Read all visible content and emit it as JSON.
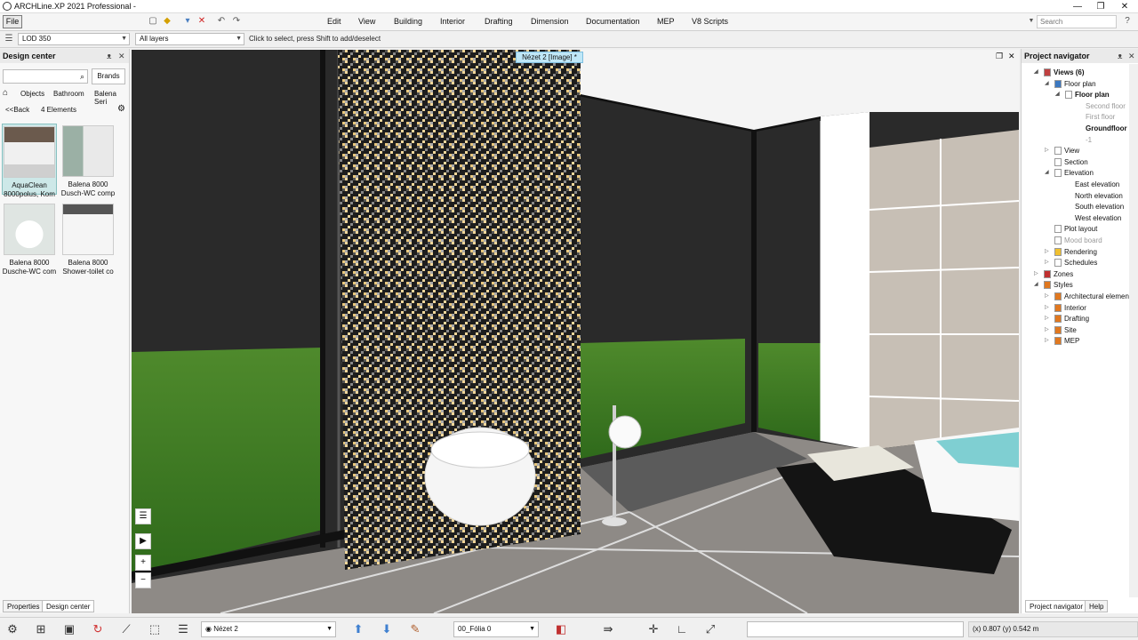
{
  "window": {
    "title": "ARCHLine.XP 2021  Professional -",
    "controls": [
      "—",
      "❐",
      "✕"
    ]
  },
  "menubar": {
    "file_label": "File",
    "items": [
      "Edit",
      "View",
      "Building",
      "Interior",
      "Drafting",
      "Dimension",
      "Documentation",
      "MEP",
      "V8 Scripts"
    ],
    "search_placeholder": "Search"
  },
  "toolbar2": {
    "lod_value": "LOD 350",
    "layers_value": "All layers",
    "hint": "Click to select, press Shift to add/deselect"
  },
  "design_center": {
    "title": "Design center",
    "brands_label": "Brands",
    "breadcrumbs": [
      "Objects",
      "Bathroom",
      "Balena Seri"
    ],
    "back_label": "<<Back",
    "count_label": "4 Elements",
    "items": [
      {
        "line1": "AquaClean",
        "line2": "8000polus, Kom",
        "selected": true
      },
      {
        "line1": "Balena 8000",
        "line2": "Dusch-WC comp",
        "selected": false
      },
      {
        "line1": "Balena 8000",
        "line2": "Dusche-WC com",
        "selected": false
      },
      {
        "line1": "Balena 8000",
        "line2": "Shower-toilet co",
        "selected": false
      }
    ],
    "tabs": [
      "Properties",
      "Design center"
    ]
  },
  "viewport": {
    "tab_label": "Nézet 2 [Image] *"
  },
  "project_navigator": {
    "title": "Project navigator",
    "tree": [
      {
        "label": "Views (6)",
        "level": 0,
        "bold": true,
        "expand": "◢",
        "icon": "views-icon"
      },
      {
        "label": "Floor plan",
        "level": 1,
        "expand": "◢",
        "icon": "floorplan-icon"
      },
      {
        "label": "Floor plan",
        "level": 2,
        "bold": true,
        "expand": "◢",
        "icon": "page-icon"
      },
      {
        "label": "Second floor",
        "level": 3,
        "greyed": true
      },
      {
        "label": "First floor",
        "level": 3,
        "greyed": true
      },
      {
        "label": "Groundfloor",
        "level": 3,
        "bold": true
      },
      {
        "label": "-1",
        "level": 3,
        "greyed": true
      },
      {
        "label": "View",
        "level": 1,
        "expand": "▷",
        "icon": "page-icon"
      },
      {
        "label": "Section",
        "level": 1,
        "icon": "page-icon"
      },
      {
        "label": "Elevation",
        "level": 1,
        "expand": "◢",
        "icon": "page-icon"
      },
      {
        "label": "East elevation",
        "level": 2
      },
      {
        "label": "North elevation",
        "level": 2
      },
      {
        "label": "South elevation",
        "level": 2
      },
      {
        "label": "West elevation",
        "level": 2
      },
      {
        "label": "Plot layout",
        "level": 1,
        "icon": "page-icon"
      },
      {
        "label": "Mood board",
        "level": 1,
        "greyed": true,
        "icon": "page-icon"
      },
      {
        "label": "Rendering",
        "level": 1,
        "expand": "▷",
        "icon": "folder-icon"
      },
      {
        "label": "Schedules",
        "level": 1,
        "expand": "▷",
        "icon": "page-icon"
      },
      {
        "label": "Zones",
        "level": 0,
        "expand": "▷",
        "icon": "zones-icon"
      },
      {
        "label": "Styles",
        "level": 0,
        "expand": "◢",
        "icon": "styles-icon"
      },
      {
        "label": "Architectural elements",
        "level": 1,
        "expand": "▷",
        "icon": "styles-icon"
      },
      {
        "label": "Interior",
        "level": 1,
        "expand": "▷",
        "icon": "styles-icon"
      },
      {
        "label": "Drafting",
        "level": 1,
        "expand": "▷",
        "icon": "styles-icon"
      },
      {
        "label": "Site",
        "level": 1,
        "expand": "▷",
        "icon": "styles-icon"
      },
      {
        "label": "MEP",
        "level": 1,
        "expand": "▷",
        "icon": "styles-icon"
      }
    ],
    "tabs": [
      "Project navigator",
      "Help"
    ]
  },
  "bottombar": {
    "view_value": "Nézet 2",
    "layer_value": "00_Fólia 0",
    "coords": "(x) 0.807  (y) 0.542 m"
  }
}
